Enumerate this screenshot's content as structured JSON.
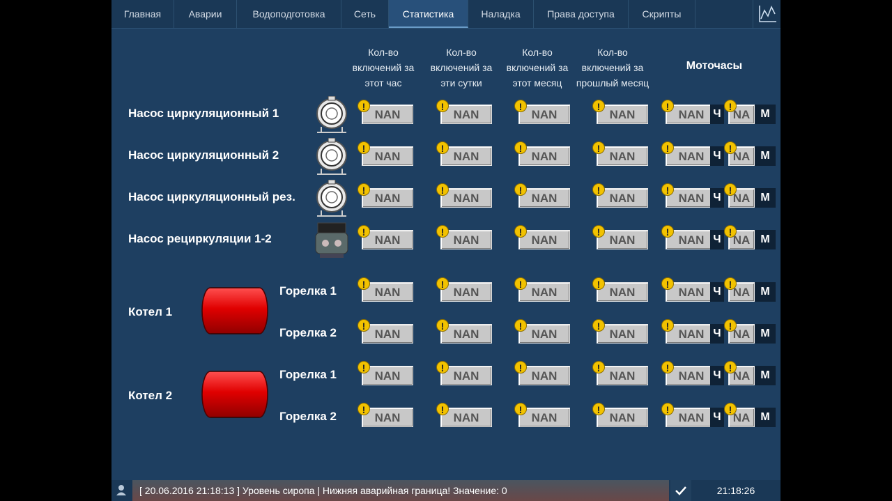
{
  "nav": {
    "tabs": [
      {
        "label": "Главная"
      },
      {
        "label": "Аварии"
      },
      {
        "label": "Водоподготовка"
      },
      {
        "label": "Сеть"
      },
      {
        "label": "Статистика"
      },
      {
        "label": "Наладка"
      },
      {
        "label": "Права доступа"
      },
      {
        "label": "Скрипты"
      }
    ],
    "active": "Статистика"
  },
  "headers": {
    "col1": "Кол-во включений за этот час",
    "col2": "Кол-во включений за эти сутки",
    "col3": "Кол-во включений за этот месяц",
    "col4": "Кол-во включений за прошлый месяц",
    "moto": "Моточасы"
  },
  "value": "NAN",
  "value_short": "NA",
  "unit_hours": "Ч",
  "unit_minutes": "М",
  "warn_glyph": "!",
  "labels": {
    "pump1": "Насос циркуляционный 1",
    "pump2": "Насос циркуляционный 2",
    "pump3": "Насос циркуляционный рез.",
    "pump4": "Насос рециркуляции 1-2",
    "boiler1": "Котел 1",
    "boiler2": "Котел 2",
    "burner1": "Горелка 1",
    "burner2": "Горелка 2"
  },
  "status": {
    "message": "[ 20.06.2016  21:18:13 ]  Уровень сиропа | Нижняя аварийная граница! Значение: 0",
    "time": "21:18:26"
  },
  "colors": {
    "background": "#1e3f61",
    "warning": "#f2c200",
    "tank": "#e00000"
  }
}
